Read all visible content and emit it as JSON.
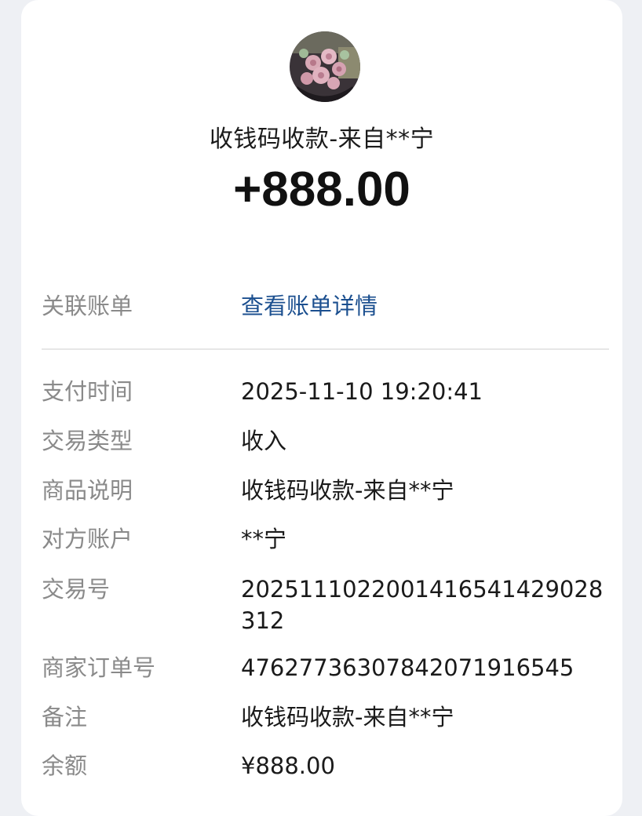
{
  "header": {
    "avatar_icon": "rose-bouquet-avatar",
    "payee_title": "收钱码收款-来自**宁",
    "amount": "+888.00"
  },
  "linked_bill": {
    "label": "关联账单",
    "value": "查看账单详情",
    "link_color": "#1b4f8f"
  },
  "details": [
    {
      "label": "支付时间",
      "value": "2025-11-10 19:20:41"
    },
    {
      "label": "交易类型",
      "value": "收入"
    },
    {
      "label": "商品说明",
      "value": "收钱码收款-来自**宁"
    },
    {
      "label": "对方账户",
      "value": "**宁"
    },
    {
      "label": "交易号",
      "value": "2025111022001416541429028312"
    },
    {
      "label": "商家订单号",
      "value": "476277363078420719165​45"
    },
    {
      "label": "备注",
      "value": "收钱码收款-来自**宁"
    },
    {
      "label": "余额",
      "value": "¥888.00"
    }
  ]
}
